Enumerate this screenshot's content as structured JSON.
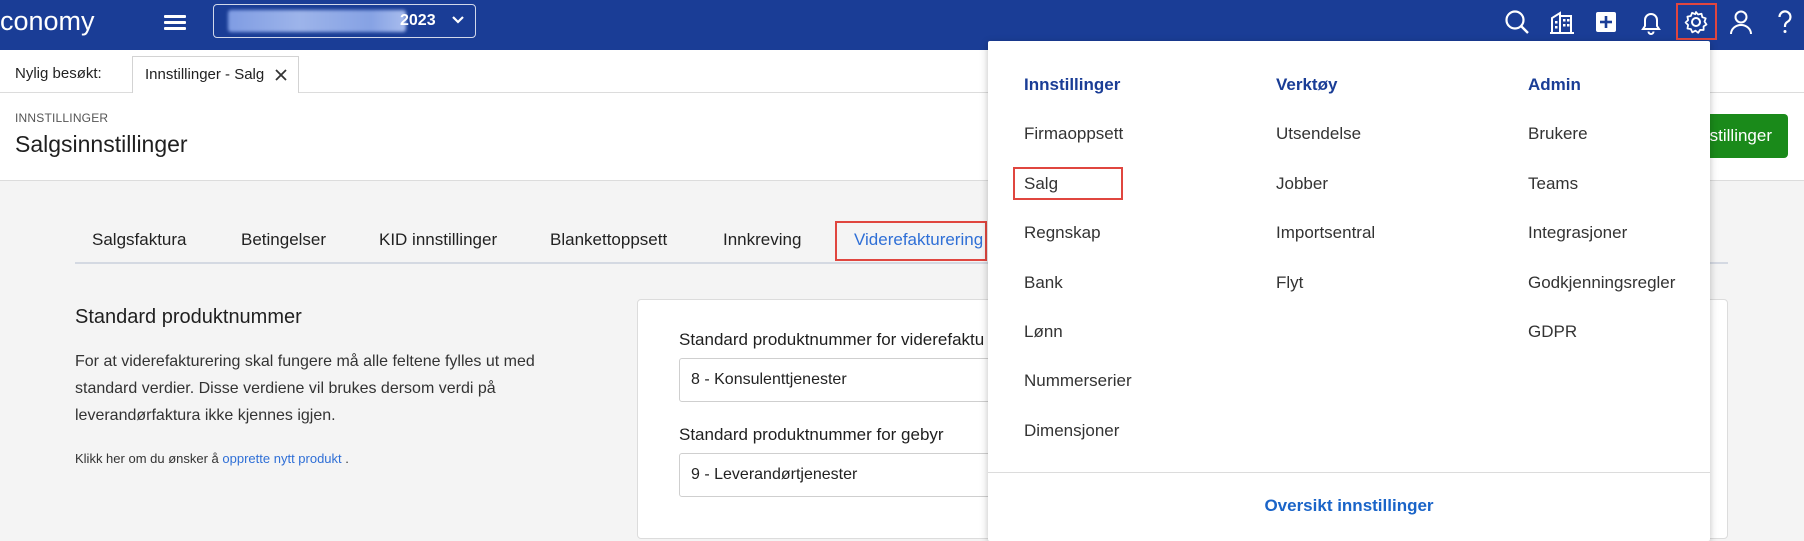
{
  "app": {
    "logo": "conomy"
  },
  "header": {
    "company_year": "2023",
    "icons": [
      "menu-icon",
      "chevron-down-icon",
      "search-icon",
      "company-building-icon",
      "add-icon",
      "notification-bell-icon",
      "settings-gear-icon",
      "user-icon",
      "help-icon"
    ]
  },
  "recent": {
    "label": "Nylig besøkt:",
    "tabs": [
      {
        "label": "Innstillinger - Salg"
      }
    ]
  },
  "page": {
    "breadcrumb": "INNSTILLINGER",
    "title": "Salgsinnstillinger",
    "action_button": "stillinger"
  },
  "tabs": [
    {
      "label": "Salgsfaktura"
    },
    {
      "label": "Betingelser"
    },
    {
      "label": "KID innstillinger"
    },
    {
      "label": "Blankettoppsett"
    },
    {
      "label": "Innkreving"
    },
    {
      "label": "Viderefakturering",
      "active": true
    }
  ],
  "section": {
    "title": "Standard produktnummer",
    "description": "For at viderefakturering skal fungere må alle feltene fylles ut med standard verdier. Disse verdiene vil brukes dersom verdi på leverandørfaktura ikke kjennes igjen.",
    "hint_prefix": "Klikk her om du ønsker å",
    "hint_link": "opprette nytt produkt",
    "hint_suffix": "."
  },
  "form": {
    "fields": [
      {
        "label": "Standard produktnummer for viderefaktu",
        "value": "8 - Konsulenttjenester"
      },
      {
        "label": "Standard produktnummer for gebyr",
        "value": "9 - Leverandørtjenester"
      }
    ]
  },
  "settings_menu": {
    "columns": [
      {
        "heading": "Innstillinger",
        "items": [
          "Firmaoppsett",
          "Salg",
          "Regnskap",
          "Bank",
          "Lønn",
          "Nummerserier",
          "Dimensjoner"
        ]
      },
      {
        "heading": "Verktøy",
        "items": [
          "Utsendelse",
          "Jobber",
          "Importsentral",
          "Flyt"
        ]
      },
      {
        "heading": "Admin",
        "items": [
          "Brukere",
          "Teams",
          "Integrasjoner",
          "Godkjenningsregler",
          "GDPR"
        ]
      }
    ],
    "footer": "Oversikt innstillinger"
  },
  "colors": {
    "topbar": "#1a3d96",
    "accent": "#2f6fd6",
    "highlight": "#e0463f",
    "primary_button": "#1a8a1a"
  }
}
